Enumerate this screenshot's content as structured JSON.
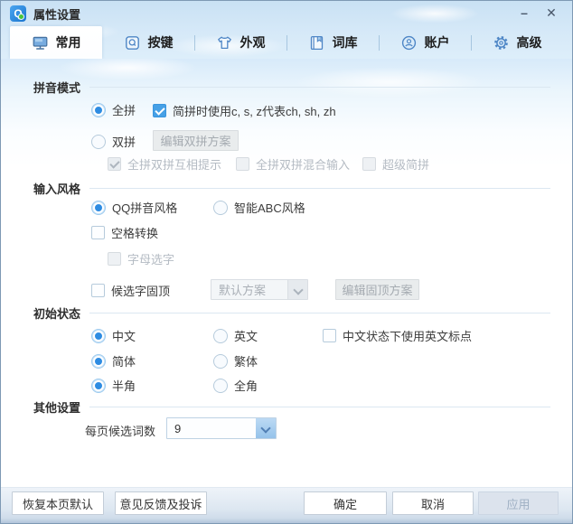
{
  "window": {
    "title": "属性设置",
    "minimize": "–",
    "close": "✕"
  },
  "tabs": [
    {
      "label": "常用"
    },
    {
      "label": "按键"
    },
    {
      "label": "外观"
    },
    {
      "label": "词库"
    },
    {
      "label": "账户"
    },
    {
      "label": "高级"
    }
  ],
  "pinyin_mode": {
    "heading": "拼音模式",
    "quanpin": "全拼",
    "jianpin_option": "简拼时使用c, s, z代表ch, sh, zh",
    "shuangpin": "双拼",
    "edit_shuangpin_button": "编辑双拼方案",
    "hint_option": "全拼双拼互相提示",
    "mixed_option": "全拼双拼混合输入",
    "super_jianpin_option": "超级简拼"
  },
  "input_style": {
    "heading": "输入风格",
    "qq_style": "QQ拼音风格",
    "abc_style": "智能ABC风格",
    "space_convert": "空格转换",
    "letter_select": "字母选字",
    "candidate_pin": "候选字固顶",
    "pin_scheme_value": "默认方案",
    "edit_pin_button": "编辑固顶方案"
  },
  "initial_state": {
    "heading": "初始状态",
    "chinese": "中文",
    "english": "英文",
    "english_punct": "中文状态下使用英文标点",
    "simplified": "简体",
    "traditional": "繁体",
    "half_width": "半角",
    "full_width": "全角"
  },
  "other_settings": {
    "heading": "其他设置",
    "candidates_label": "每页候选词数",
    "candidates_value": "9"
  },
  "footer": {
    "restore": "恢复本页默认",
    "feedback": "意见反馈及投诉",
    "ok": "确定",
    "cancel": "取消",
    "apply": "应用"
  },
  "colors": {
    "accent": "#2e8ce2",
    "tab_icon": "#4e86c6",
    "checked_checkbox": "#46a0e6"
  }
}
